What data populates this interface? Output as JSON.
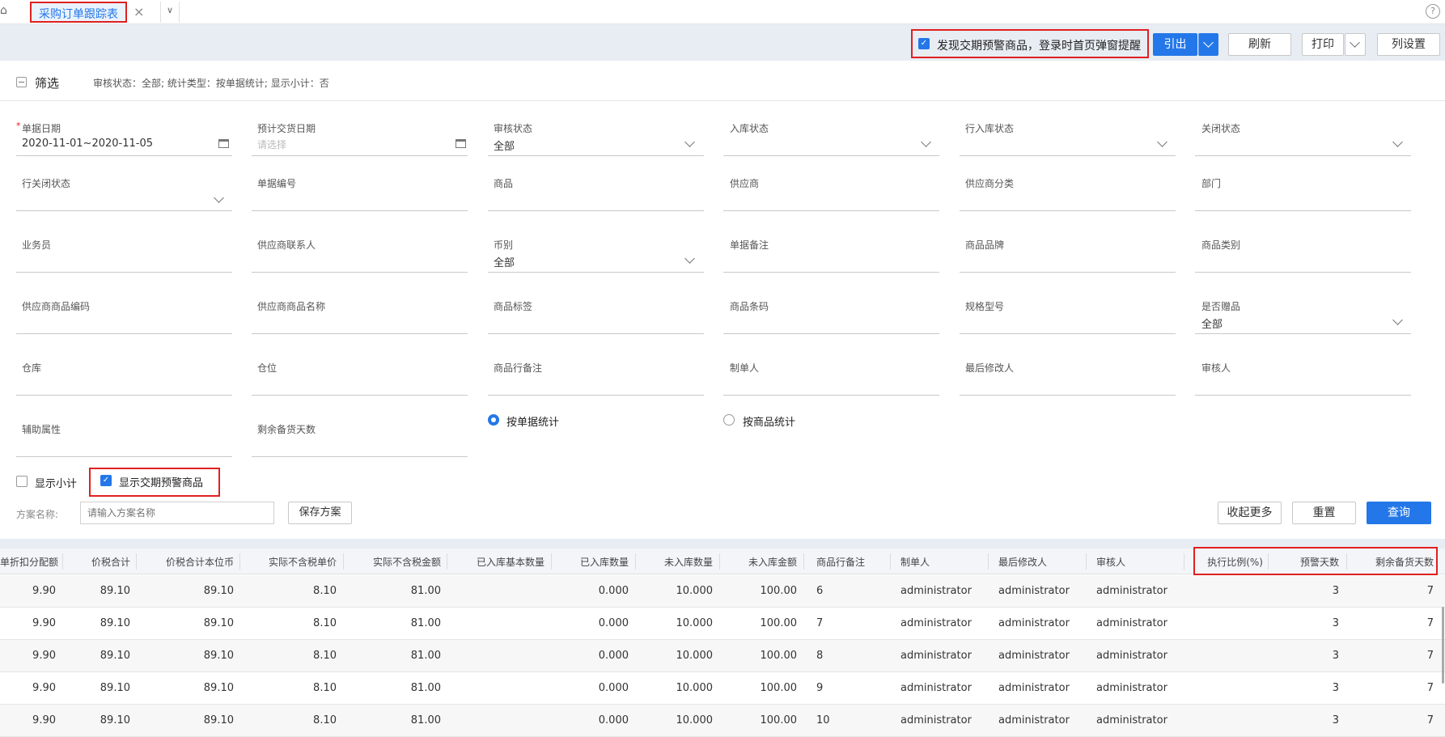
{
  "tabbar": {
    "home_icon": "home-icon",
    "active_tab": "采购订单跟踪表",
    "close_icon": "close-icon",
    "help_icon": "?"
  },
  "toolbar": {
    "warn_checkbox_label": "发现交期预警商品，登录时首页弹窗提醒",
    "export_label": "引出",
    "refresh_label": "刷新",
    "print_label": "打印",
    "columns_label": "列设置"
  },
  "filter": {
    "title": "筛选",
    "summary": "审核状态：全部; 统计类型：按单据统计; 显示小计：否"
  },
  "fields": {
    "date_label": "单据日期",
    "date_required": "*",
    "date_value": "2020-11-01~2020-11-05",
    "delivery_label": "预计交货日期",
    "delivery_placeholder": "请选择",
    "audit_label": "审核状态",
    "audit_value": "全部",
    "instock_label": "入库状态",
    "line_instock_label": "行入库状态",
    "close_label": "关闭状态",
    "line_close_label": "行关闭状态",
    "billno_label": "单据编号",
    "goods_label": "商品",
    "supplier_label": "供应商",
    "supplier_class_label": "供应商分类",
    "dept_label": "部门",
    "salesman_label": "业务员",
    "supplier_contact_label": "供应商联系人",
    "currency_label": "币别",
    "currency_value": "全部",
    "bill_remark_label": "单据备注",
    "brand_label": "商品品牌",
    "goods_category_label": "商品类别",
    "supplier_goods_code_label": "供应商商品编码",
    "supplier_goods_name_label": "供应商商品名称",
    "goods_tag_label": "商品标签",
    "barcode_label": "商品条码",
    "spec_label": "规格型号",
    "gift_label": "是否赠品",
    "gift_value": "全部",
    "warehouse_label": "仓库",
    "location_label": "仓位",
    "line_remark_label": "商品行备注",
    "creator_label": "制单人",
    "modifier_label": "最后修改人",
    "auditor_label": "审核人",
    "aux_label": "辅助属性",
    "remain_days_label": "剩余备货天数",
    "by_bill_label": "按单据统计",
    "by_goods_label": "按商品统计",
    "show_subtotal_label": "显示小计",
    "show_warn_label": "显示交期预警商品",
    "scheme_label": "方案名称:",
    "scheme_placeholder": "请输入方案名称",
    "save_scheme_label": "保存方案",
    "collapse_label": "收起更多",
    "reset_label": "重置",
    "query_label": "查询"
  },
  "table": {
    "headers": [
      "单折扣分配额",
      "价税合计",
      "价税合计本位币",
      "实际不含税单价",
      "实际不含税金额",
      "已入库基本数量",
      "已入库数量",
      "未入库数量",
      "未入库金额",
      "商品行备注",
      "制单人",
      "最后修改人",
      "审核人",
      "执行比例(%)",
      "预警天数",
      "剩余备货天数"
    ],
    "rows": [
      [
        "9.90",
        "89.10",
        "89.10",
        "8.10",
        "81.00",
        "",
        "0.000",
        "10.000",
        "100.00",
        "6",
        "administrator",
        "administrator",
        "administrator",
        "",
        "3",
        "7"
      ],
      [
        "9.90",
        "89.10",
        "89.10",
        "8.10",
        "81.00",
        "",
        "0.000",
        "10.000",
        "100.00",
        "7",
        "administrator",
        "administrator",
        "administrator",
        "",
        "3",
        "7"
      ],
      [
        "9.90",
        "89.10",
        "89.10",
        "8.10",
        "81.00",
        "",
        "0.000",
        "10.000",
        "100.00",
        "8",
        "administrator",
        "administrator",
        "administrator",
        "",
        "3",
        "7"
      ],
      [
        "9.90",
        "89.10",
        "89.10",
        "8.10",
        "81.00",
        "",
        "0.000",
        "10.000",
        "100.00",
        "9",
        "administrator",
        "administrator",
        "administrator",
        "",
        "3",
        "7"
      ],
      [
        "9.90",
        "89.10",
        "89.10",
        "8.10",
        "81.00",
        "",
        "0.000",
        "10.000",
        "100.00",
        "10",
        "administrator",
        "administrator",
        "administrator",
        "",
        "3",
        "7"
      ]
    ]
  },
  "colors": {
    "accent": "#2477e8",
    "highlight": "#e02020",
    "toolbar_bg": "#e8edf4"
  }
}
